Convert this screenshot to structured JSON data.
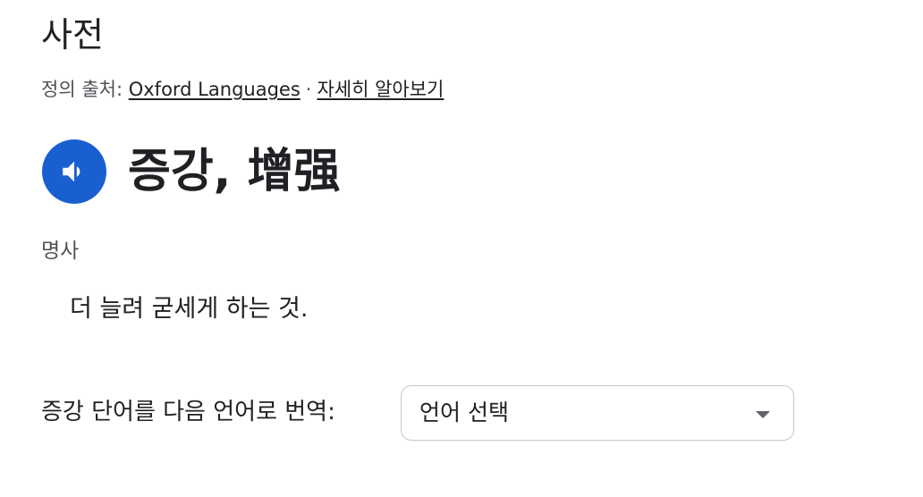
{
  "header": {
    "title": "사전"
  },
  "source": {
    "prefix": "정의 출처: ",
    "provider_link": "Oxford Languages",
    "separator": "·",
    "learn_more_link": "자세히 알아보기"
  },
  "entry": {
    "speaker_icon": "speaker-icon",
    "headword": "증강, 增强",
    "part_of_speech": "명사",
    "definition": "더 늘려 굳세게 하는 것."
  },
  "translate": {
    "label": "증강 단어를 다음 언어로 번역:",
    "select_value": "언어 선택",
    "dropdown_icon": "caret-down-icon"
  },
  "colors": {
    "accent": "#1a5fd0",
    "text": "#202124",
    "secondary_text": "#4d5156"
  }
}
